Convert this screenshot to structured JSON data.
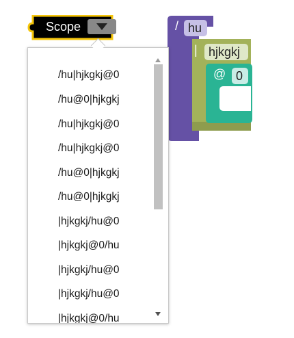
{
  "scope_block": {
    "label": "Scope",
    "dropdown_icon": "chevron-down-icon",
    "color": "#000000",
    "outline_color": "#f6c60a"
  },
  "blocks": {
    "path_block": {
      "symbol": "/",
      "field": "hu",
      "color": "#6551a5"
    },
    "pipe_block": {
      "symbol": "|",
      "field": "hjkgkj",
      "color": "#a3b25a"
    },
    "at_block": {
      "symbol": "@",
      "field": "0",
      "color": "#2ab494"
    }
  },
  "menu": {
    "items": [
      "/hu|hjkgkj@0",
      "/hu@0|hjkgkj",
      "/hu|hjkgkj@0",
      "/hu|hjkgkj@0",
      "/hu@0|hjkgkj",
      "/hu@0|hjkgkj",
      "|hjkgkj/hu@0",
      "|hjkgkj@0/hu",
      "|hjkgkj/hu@0",
      "|hjkgkj/hu@0",
      "|hjkgkj@0/hu"
    ]
  }
}
